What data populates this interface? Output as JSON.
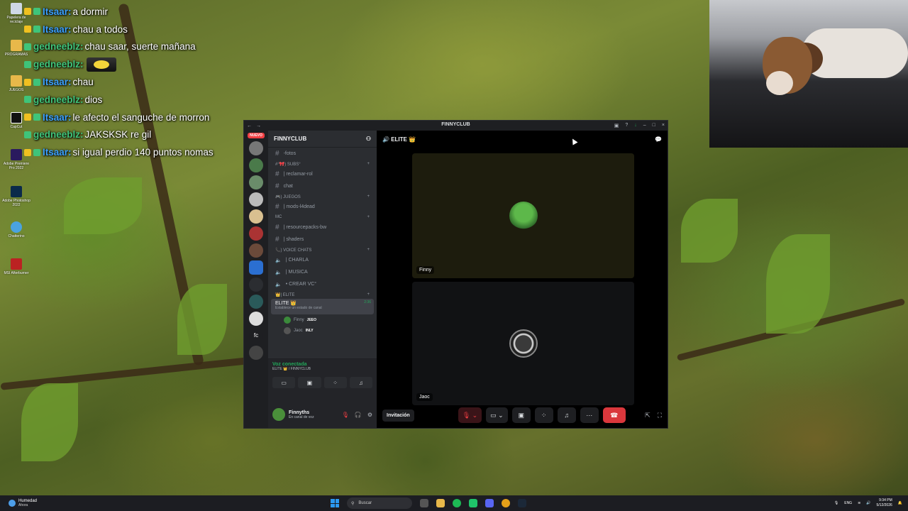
{
  "desktop_icons": [
    {
      "label": "Papelera de reciclaje",
      "icon": "recycle-bin-icon"
    },
    {
      "label": "PROGRAMAS",
      "icon": "folder-icon"
    },
    {
      "label": "JUEGOS",
      "icon": "folder-icon"
    },
    {
      "label": "CapCut",
      "icon": "capcut-icon"
    },
    {
      "label": "Adobe Premiere Pro 2022",
      "icon": "premiere-icon"
    },
    {
      "label": "Adobe Photoshop 2022",
      "icon": "photoshop-icon"
    },
    {
      "label": "Chatterino",
      "icon": "chatterino-icon"
    },
    {
      "label": "MSI Afterburner",
      "icon": "afterburner-icon"
    }
  ],
  "chat": [
    {
      "user": "Itsaar:",
      "color": "#3aa0ff",
      "message": "a dormir"
    },
    {
      "user": "Itsaar:",
      "color": "#3aa0ff",
      "message": "chau a todos"
    },
    {
      "user": "gedneeblz:",
      "color": "#3fc47a",
      "message": "chau saar, suerte mañana"
    },
    {
      "user": "gedneeblz:",
      "color": "#3fc47a",
      "message": ""
    },
    {
      "user": "Itsaar:",
      "color": "#3aa0ff",
      "message": "chau"
    },
    {
      "user": "gedneeblz:",
      "color": "#3fc47a",
      "message": "dios"
    },
    {
      "user": "Itsaar:",
      "color": "#3aa0ff",
      "message": "le afecto el sanguche de morron"
    },
    {
      "user": "gedneeblz:",
      "color": "#3fc47a",
      "message": "JAKSKSK re gil"
    },
    {
      "user": "Itsaar:",
      "color": "#3aa0ff",
      "message": "si igual perdio 140 puntos nomas"
    }
  ],
  "discord": {
    "window_title": "FINNYCLUB",
    "server_name": "FINNYCLUB",
    "nuevo_badge": "NUEVO",
    "channel_list": [
      {
        "kind": "channel",
        "label": "-fotos"
      },
      {
        "kind": "category",
        "label": "#°🎀) SUBS°"
      },
      {
        "kind": "channel",
        "label": "| reclamar-rol"
      },
      {
        "kind": "channel",
        "label": "chat"
      },
      {
        "kind": "category",
        "label": "🎮) JUEGOS"
      },
      {
        "kind": "channel",
        "label": "| mods-l4dead"
      },
      {
        "kind": "category",
        "label": "MC"
      },
      {
        "kind": "channel",
        "label": "| resourcepacks-bw"
      },
      {
        "kind": "channel",
        "label": "| shaders"
      },
      {
        "kind": "category",
        "label": "📞) VOICE CHATS"
      },
      {
        "kind": "voice",
        "label": "| CHARLA"
      },
      {
        "kind": "voice",
        "label": "| MUSICA"
      },
      {
        "kind": "voice",
        "label": "• CREAR VC°"
      },
      {
        "kind": "category",
        "label": "👑| ELITE"
      }
    ],
    "active_channel": {
      "label": "ELITE 👑",
      "sub": "Establece un estado de canal",
      "time": "2:36"
    },
    "members": [
      {
        "name": "Finny",
        "tag": "JEEO"
      },
      {
        "name": "Jaoc",
        "tag": "INLY"
      }
    ],
    "voice_panel": {
      "status": "Voz conectada",
      "location": "ELITE 👑 / FINNYCLUB"
    },
    "user": {
      "name": "Finnyths",
      "status": "En canal de voz"
    },
    "main_channel": "ELITE 👑",
    "tiles": [
      {
        "name": "Finny"
      },
      {
        "name": "Jaoc"
      }
    ],
    "invite_label": "Invitación"
  },
  "taskbar": {
    "weather_title": "Humedad",
    "weather_sub": "Ahora",
    "search_placeholder": "Buscar",
    "lang": "ENG",
    "time": "9:34 PM",
    "date": "5/12/2026"
  }
}
